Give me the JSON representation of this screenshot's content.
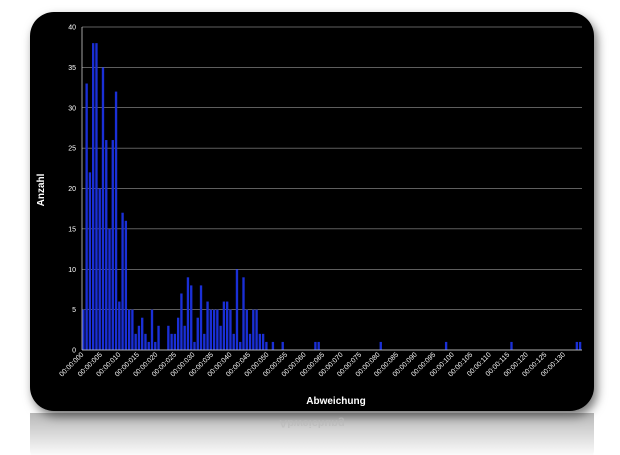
{
  "chart_data": {
    "type": "bar",
    "xlabel": "Abweichung",
    "ylabel": "Anzahl",
    "ylim": [
      0,
      40
    ],
    "yticks": [
      "0",
      "5",
      "10",
      "15",
      "20",
      "25",
      "30",
      "35",
      "40"
    ],
    "grid": true,
    "bar_color": "#1a2fd6",
    "background": "#000000",
    "xtick_labels": [
      "00:00:000",
      "00:00:005",
      "00:00:010",
      "00:00:015",
      "00:00:020",
      "00:00:025",
      "00:00:030",
      "00:00:035",
      "00:00:040",
      "00:00:045",
      "00:00:050",
      "00:00:055",
      "00:00:060",
      "00:00:065",
      "00:00:070",
      "00:00:075",
      "00:00:080",
      "00:00:085",
      "00:00:090",
      "00:00:095",
      "00:00:100",
      "00:00:105",
      "00:00:110",
      "00:00:115",
      "00:00:120",
      "00:00:125",
      "00:00:130"
    ],
    "values": [
      5,
      33,
      22,
      38,
      38,
      20,
      35,
      26,
      15,
      26,
      32,
      6,
      17,
      16,
      5,
      5,
      2,
      3,
      4,
      2,
      1,
      5,
      1,
      3,
      0,
      0,
      3,
      2,
      2,
      4,
      7,
      3,
      9,
      8,
      1,
      4,
      8,
      2,
      6,
      5,
      5,
      5,
      3,
      6,
      6,
      5,
      2,
      10,
      1,
      9,
      5,
      2,
      5,
      5,
      2,
      2,
      1,
      0,
      1,
      0,
      0,
      1,
      0,
      0,
      0,
      0,
      0,
      0,
      0,
      0,
      0,
      1,
      1,
      0,
      0,
      0,
      0,
      0,
      0,
      0,
      0,
      0,
      0,
      0,
      0,
      0,
      0,
      0,
      0,
      0,
      0,
      1,
      0,
      0,
      0,
      0,
      0,
      0,
      0,
      0,
      0,
      0,
      0,
      0,
      0,
      0,
      0,
      0,
      0,
      0,
      0,
      1,
      0,
      0,
      0,
      0,
      0,
      0,
      0,
      0,
      0,
      0,
      0,
      0,
      0,
      0,
      0,
      0,
      0,
      0,
      0,
      1,
      0,
      0,
      0,
      0,
      0,
      0,
      0,
      0,
      0,
      0,
      0,
      0,
      0,
      0,
      0,
      0,
      0,
      0,
      0,
      1,
      1
    ]
  },
  "reflection_text": "Abweichung"
}
